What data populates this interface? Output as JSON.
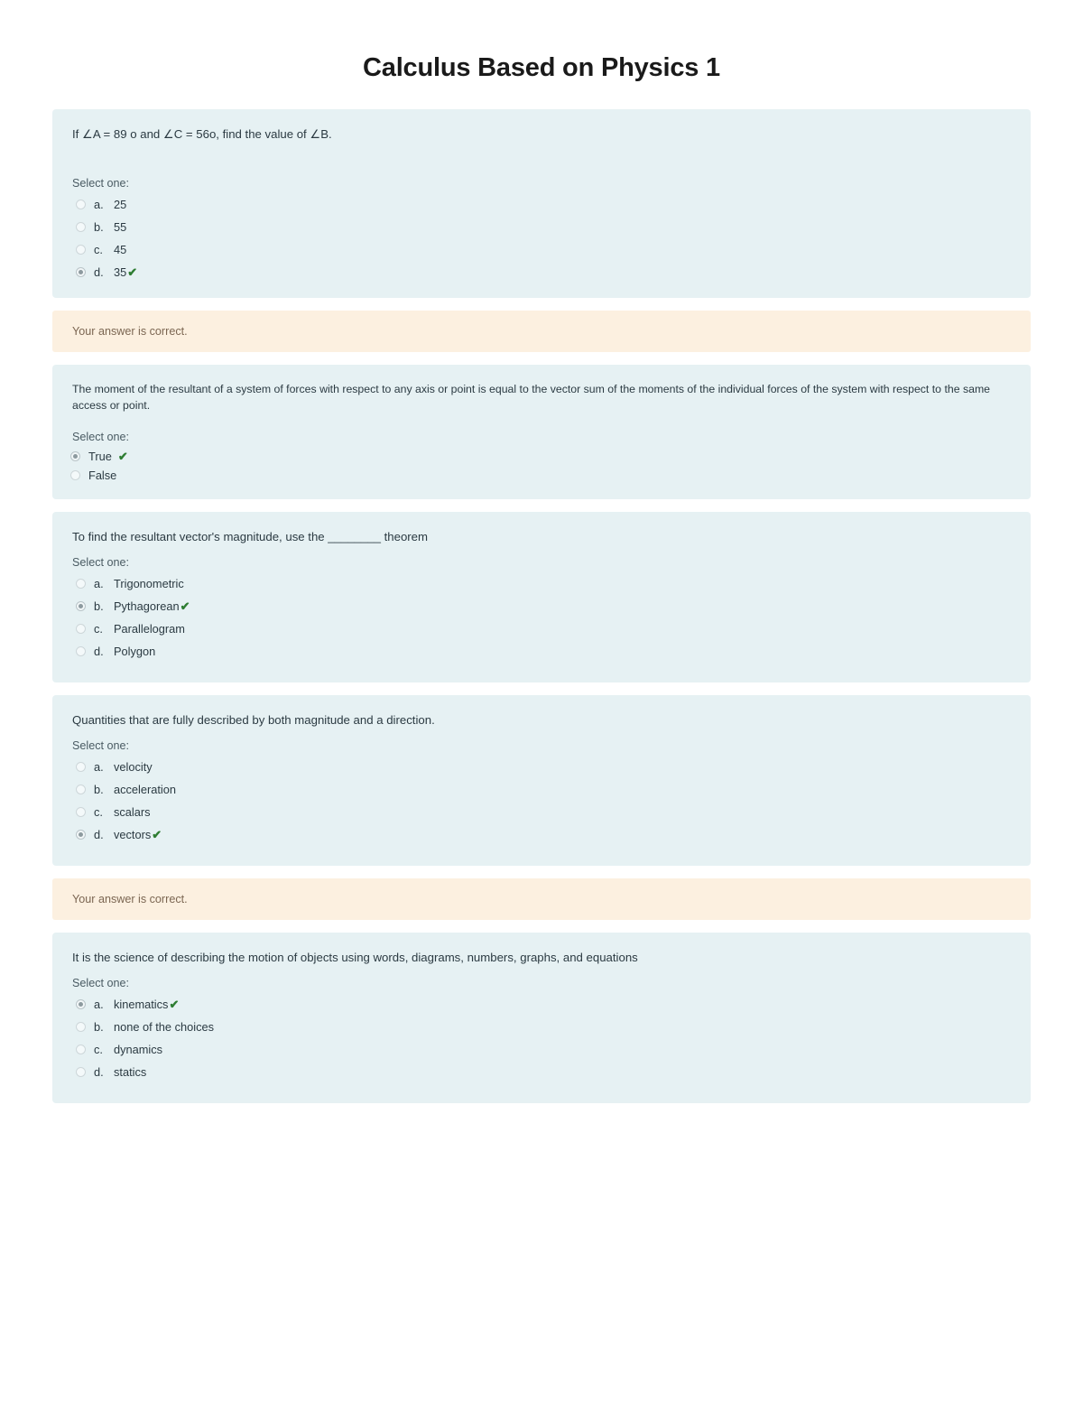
{
  "page": {
    "title": "Calculus Based on Physics 1"
  },
  "labels": {
    "select_one": "Select one:",
    "correct_tick": "✔"
  },
  "blocks": [
    {
      "kind": "question",
      "id": "q1",
      "text": "If ∠A = 89 o and ∠C = 56o, find the value of ∠B.",
      "select_one": "Select one:",
      "style": "gap-after-stem",
      "options": [
        {
          "letter": "a.",
          "text": "25",
          "selected": false,
          "correct": false
        },
        {
          "letter": "b.",
          "text": "55",
          "selected": false,
          "correct": false
        },
        {
          "letter": "c.",
          "text": "45",
          "selected": false,
          "correct": false
        },
        {
          "letter": "d.",
          "text": "35",
          "selected": true,
          "correct": true
        }
      ]
    },
    {
      "kind": "feedback",
      "id": "fb1",
      "text": "Your answer is correct."
    },
    {
      "kind": "question",
      "id": "q2",
      "text": "The moment of the resultant of a system of forces with respect to any axis or point is equal to the vector sum of the moments of the individual forces of the system with respect to the same access or point.",
      "select_one": "Select one:",
      "style": "true-false",
      "options": [
        {
          "letter": "",
          "text": "True",
          "selected": true,
          "correct": true
        },
        {
          "letter": "",
          "text": "False",
          "selected": false,
          "correct": false
        }
      ]
    },
    {
      "kind": "question",
      "id": "q3",
      "text": "To find the resultant vector's magnitude, use the ________ theorem",
      "select_one": "Select one:",
      "style": "normal",
      "options": [
        {
          "letter": "a.",
          "text": "Trigonometric",
          "selected": false,
          "correct": false
        },
        {
          "letter": "b.",
          "text": "Pythagorean",
          "selected": true,
          "correct": true
        },
        {
          "letter": "c.",
          "text": "Parallelogram",
          "selected": false,
          "correct": false
        },
        {
          "letter": "d.",
          "text": "Polygon",
          "selected": false,
          "correct": false
        }
      ]
    },
    {
      "kind": "question",
      "id": "q4",
      "text": "Quantities that are fully described by both magnitude and a direction.",
      "select_one": "Select one:",
      "style": "normal",
      "options": [
        {
          "letter": "a.",
          "text": "velocity",
          "selected": false,
          "correct": false
        },
        {
          "letter": "b.",
          "text": "acceleration",
          "selected": false,
          "correct": false
        },
        {
          "letter": "c.",
          "text": "scalars",
          "selected": false,
          "correct": false
        },
        {
          "letter": "d.",
          "text": "vectors",
          "selected": true,
          "correct": true
        }
      ]
    },
    {
      "kind": "feedback",
      "id": "fb2",
      "text": "Your answer is correct."
    },
    {
      "kind": "question",
      "id": "q5",
      "text": "It is the science of describing the motion of objects using words, diagrams, numbers, graphs, and equations",
      "select_one": "Select one:",
      "style": "normal",
      "options": [
        {
          "letter": "a.",
          "text": "kinematics",
          "selected": true,
          "correct": true
        },
        {
          "letter": "b.",
          "text": "none of the choices",
          "selected": false,
          "correct": false
        },
        {
          "letter": "c.",
          "text": "dynamics",
          "selected": false,
          "correct": false
        },
        {
          "letter": "d.",
          "text": "statics",
          "selected": false,
          "correct": false
        }
      ]
    }
  ],
  "colors": {
    "question_bg": "#e6f1f3",
    "feedback_bg": "#fcf0e0",
    "feedback_text": "#7b6652",
    "body_text": "#2b3a42",
    "correct_green": "#2e7d32",
    "page_bg": "#ffffff"
  }
}
